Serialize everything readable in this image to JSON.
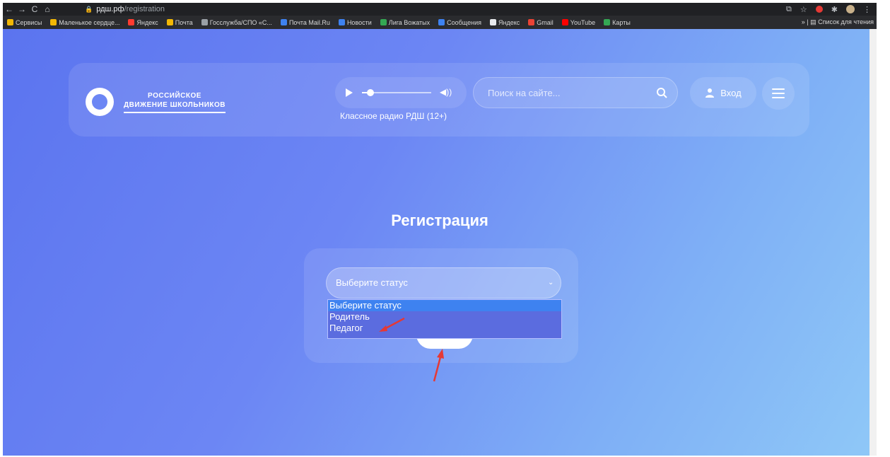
{
  "browser": {
    "url_host": "рдш.рф",
    "url_path": "/registration",
    "bookmarks": [
      {
        "label": "Сервисы",
        "color": "#f2b705"
      },
      {
        "label": "Маленькое сердце...",
        "color": "#f2b705"
      },
      {
        "label": "Яндекс",
        "color": "#ff3b30"
      },
      {
        "label": "Почта",
        "color": "#f2b705"
      },
      {
        "label": "Госслужба/СПО «С...",
        "color": "#9aa0a6"
      },
      {
        "label": "Почта Mail.Ru",
        "color": "#3e82f0"
      },
      {
        "label": "Новости",
        "color": "#3e82f0"
      },
      {
        "label": "Лига Вожатых",
        "color": "#34a853"
      },
      {
        "label": "Сообщения",
        "color": "#3e82f0"
      },
      {
        "label": "Яндекс",
        "color": "#e8eaed"
      },
      {
        "label": "Gmail",
        "color": "#ea4335"
      },
      {
        "label": "YouTube",
        "color": "#ff0000"
      },
      {
        "label": "Карты",
        "color": "#34a853"
      }
    ],
    "reading_list": "Список для чтения"
  },
  "header": {
    "logo_line1": "РОССИЙСКОЕ",
    "logo_line2": "ДВИЖЕНИЕ ШКОЛЬНИКОВ",
    "radio_label": "Классное радио РДШ (12+)",
    "player_progress": 0.12,
    "search_placeholder": "Поиск на сайте...",
    "login_label": "Вход"
  },
  "main": {
    "title": "Регистрация",
    "select_value": "Выберите статус",
    "options": [
      "Выберите статус",
      "Родитель",
      "Педагог"
    ]
  },
  "colors": {
    "accent": "#3e82f0",
    "annotation": "#e53935"
  }
}
